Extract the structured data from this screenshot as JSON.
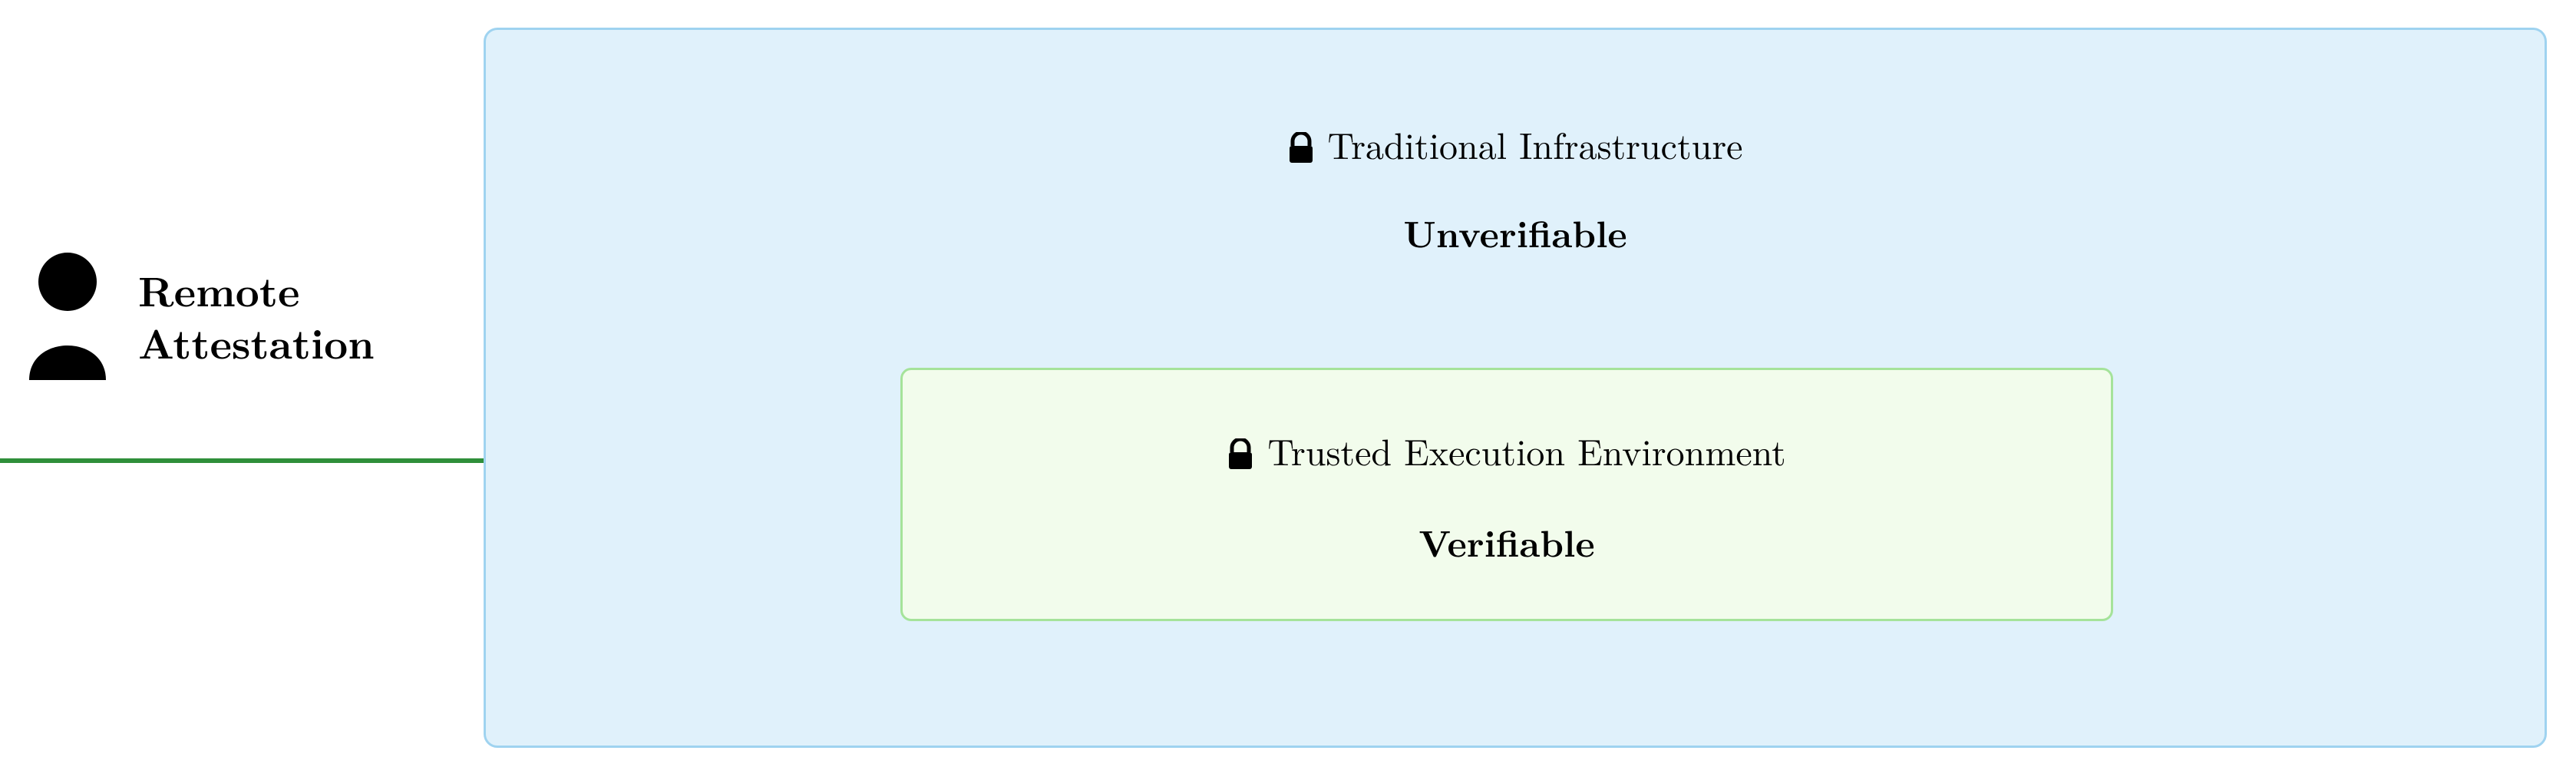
{
  "user": {
    "label_line1": "Remote",
    "label_line2": "Attestation"
  },
  "outer": {
    "icon_name": "lock-icon",
    "title": "Traditional Infrastructure",
    "status": "Unverifiable"
  },
  "inner": {
    "icon_name": "lock-icon",
    "title": "Trusted Execution Environment",
    "status": "Verifiable"
  },
  "colors": {
    "outer_bg": "#e0f1fb",
    "outer_border": "#9fd3f0",
    "inner_bg": "#f2fcec",
    "inner_border": "#a5e39a",
    "arrow": "#2f8f3a"
  }
}
